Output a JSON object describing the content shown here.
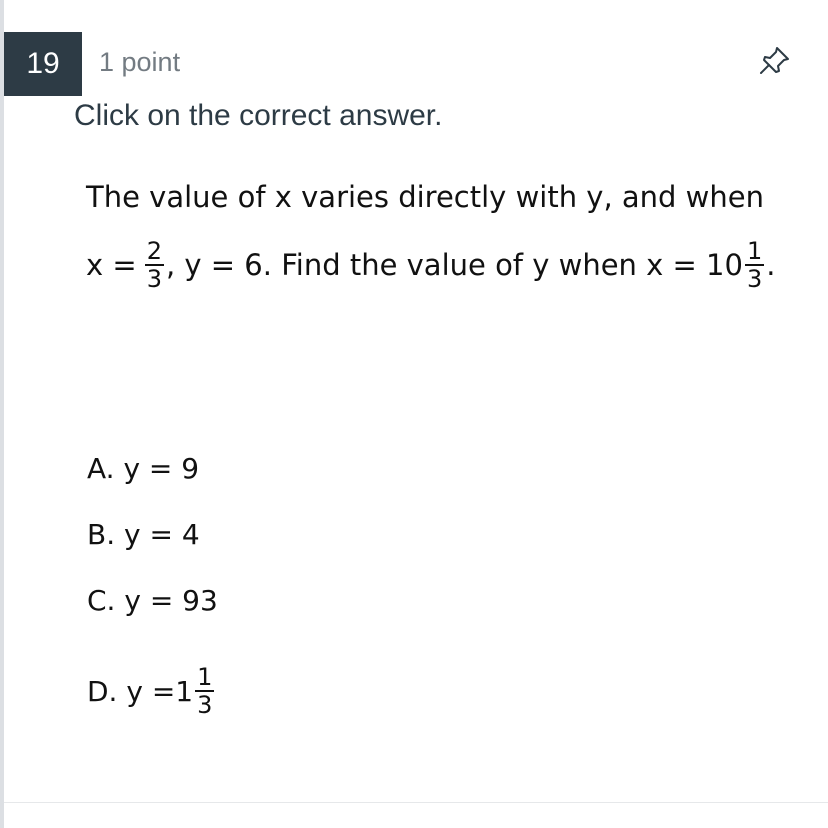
{
  "question": {
    "number": "19",
    "points": "1 point",
    "instruction": "Click on the correct answer.",
    "line1": "The value of x varies directly with y, and when",
    "line2": {
      "x_label": "x =",
      "frac1_num": "2",
      "frac1_den": "3",
      "mid_text": ", y = 6. Find the value of y when x = 10",
      "frac2_num": "1",
      "frac2_den": "3",
      "end_text": "."
    }
  },
  "answers": [
    {
      "label": "A. y = 9"
    },
    {
      "label": "B. y = 4"
    },
    {
      "label": "C. y = 93"
    },
    {
      "label": "D. y =1",
      "frac_num": "1",
      "frac_den": "3"
    }
  ],
  "icons": {
    "pin": "pin-icon"
  },
  "colors": {
    "number_badge": "#2d3b45",
    "points_text": "#737b82",
    "instruction_text": "#2d3b45"
  }
}
